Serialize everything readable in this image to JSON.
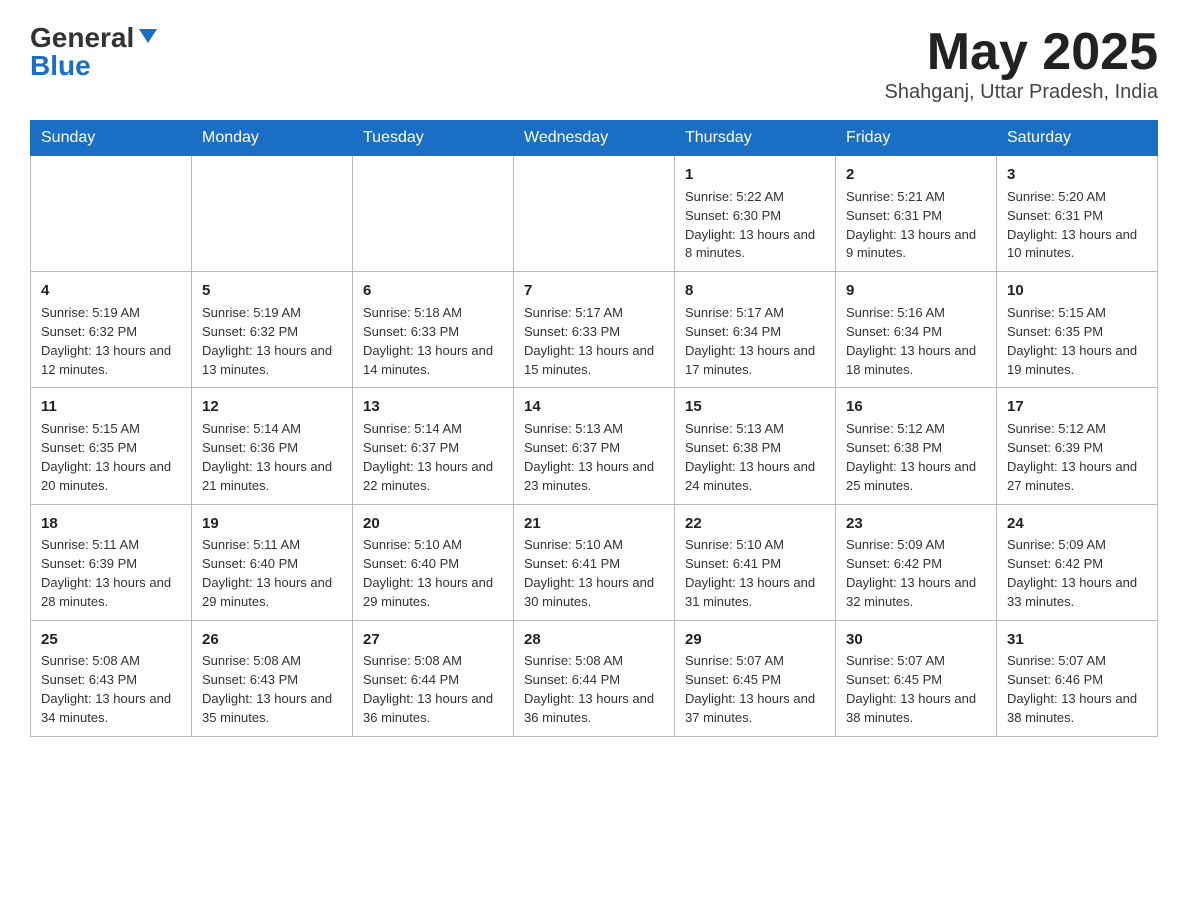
{
  "logo": {
    "general": "General",
    "blue": "Blue"
  },
  "header": {
    "month_title": "May 2025",
    "location": "Shahganj, Uttar Pradesh, India"
  },
  "days_of_week": [
    "Sunday",
    "Monday",
    "Tuesday",
    "Wednesday",
    "Thursday",
    "Friday",
    "Saturday"
  ],
  "weeks": [
    [
      {
        "day": "",
        "info": ""
      },
      {
        "day": "",
        "info": ""
      },
      {
        "day": "",
        "info": ""
      },
      {
        "day": "",
        "info": ""
      },
      {
        "day": "1",
        "info": "Sunrise: 5:22 AM\nSunset: 6:30 PM\nDaylight: 13 hours and 8 minutes."
      },
      {
        "day": "2",
        "info": "Sunrise: 5:21 AM\nSunset: 6:31 PM\nDaylight: 13 hours and 9 minutes."
      },
      {
        "day": "3",
        "info": "Sunrise: 5:20 AM\nSunset: 6:31 PM\nDaylight: 13 hours and 10 minutes."
      }
    ],
    [
      {
        "day": "4",
        "info": "Sunrise: 5:19 AM\nSunset: 6:32 PM\nDaylight: 13 hours and 12 minutes."
      },
      {
        "day": "5",
        "info": "Sunrise: 5:19 AM\nSunset: 6:32 PM\nDaylight: 13 hours and 13 minutes."
      },
      {
        "day": "6",
        "info": "Sunrise: 5:18 AM\nSunset: 6:33 PM\nDaylight: 13 hours and 14 minutes."
      },
      {
        "day": "7",
        "info": "Sunrise: 5:17 AM\nSunset: 6:33 PM\nDaylight: 13 hours and 15 minutes."
      },
      {
        "day": "8",
        "info": "Sunrise: 5:17 AM\nSunset: 6:34 PM\nDaylight: 13 hours and 17 minutes."
      },
      {
        "day": "9",
        "info": "Sunrise: 5:16 AM\nSunset: 6:34 PM\nDaylight: 13 hours and 18 minutes."
      },
      {
        "day": "10",
        "info": "Sunrise: 5:15 AM\nSunset: 6:35 PM\nDaylight: 13 hours and 19 minutes."
      }
    ],
    [
      {
        "day": "11",
        "info": "Sunrise: 5:15 AM\nSunset: 6:35 PM\nDaylight: 13 hours and 20 minutes."
      },
      {
        "day": "12",
        "info": "Sunrise: 5:14 AM\nSunset: 6:36 PM\nDaylight: 13 hours and 21 minutes."
      },
      {
        "day": "13",
        "info": "Sunrise: 5:14 AM\nSunset: 6:37 PM\nDaylight: 13 hours and 22 minutes."
      },
      {
        "day": "14",
        "info": "Sunrise: 5:13 AM\nSunset: 6:37 PM\nDaylight: 13 hours and 23 minutes."
      },
      {
        "day": "15",
        "info": "Sunrise: 5:13 AM\nSunset: 6:38 PM\nDaylight: 13 hours and 24 minutes."
      },
      {
        "day": "16",
        "info": "Sunrise: 5:12 AM\nSunset: 6:38 PM\nDaylight: 13 hours and 25 minutes."
      },
      {
        "day": "17",
        "info": "Sunrise: 5:12 AM\nSunset: 6:39 PM\nDaylight: 13 hours and 27 minutes."
      }
    ],
    [
      {
        "day": "18",
        "info": "Sunrise: 5:11 AM\nSunset: 6:39 PM\nDaylight: 13 hours and 28 minutes."
      },
      {
        "day": "19",
        "info": "Sunrise: 5:11 AM\nSunset: 6:40 PM\nDaylight: 13 hours and 29 minutes."
      },
      {
        "day": "20",
        "info": "Sunrise: 5:10 AM\nSunset: 6:40 PM\nDaylight: 13 hours and 29 minutes."
      },
      {
        "day": "21",
        "info": "Sunrise: 5:10 AM\nSunset: 6:41 PM\nDaylight: 13 hours and 30 minutes."
      },
      {
        "day": "22",
        "info": "Sunrise: 5:10 AM\nSunset: 6:41 PM\nDaylight: 13 hours and 31 minutes."
      },
      {
        "day": "23",
        "info": "Sunrise: 5:09 AM\nSunset: 6:42 PM\nDaylight: 13 hours and 32 minutes."
      },
      {
        "day": "24",
        "info": "Sunrise: 5:09 AM\nSunset: 6:42 PM\nDaylight: 13 hours and 33 minutes."
      }
    ],
    [
      {
        "day": "25",
        "info": "Sunrise: 5:08 AM\nSunset: 6:43 PM\nDaylight: 13 hours and 34 minutes."
      },
      {
        "day": "26",
        "info": "Sunrise: 5:08 AM\nSunset: 6:43 PM\nDaylight: 13 hours and 35 minutes."
      },
      {
        "day": "27",
        "info": "Sunrise: 5:08 AM\nSunset: 6:44 PM\nDaylight: 13 hours and 36 minutes."
      },
      {
        "day": "28",
        "info": "Sunrise: 5:08 AM\nSunset: 6:44 PM\nDaylight: 13 hours and 36 minutes."
      },
      {
        "day": "29",
        "info": "Sunrise: 5:07 AM\nSunset: 6:45 PM\nDaylight: 13 hours and 37 minutes."
      },
      {
        "day": "30",
        "info": "Sunrise: 5:07 AM\nSunset: 6:45 PM\nDaylight: 13 hours and 38 minutes."
      },
      {
        "day": "31",
        "info": "Sunrise: 5:07 AM\nSunset: 6:46 PM\nDaylight: 13 hours and 38 minutes."
      }
    ]
  ]
}
